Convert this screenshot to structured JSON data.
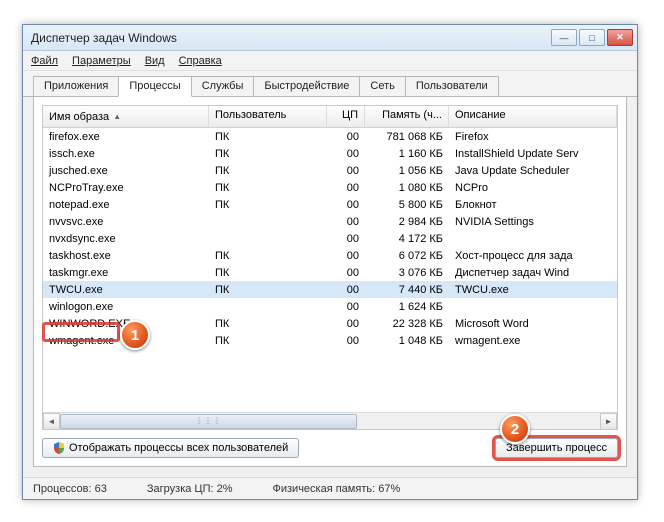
{
  "window": {
    "title": "Диспетчер задач Windows"
  },
  "menu": {
    "file": "Файл",
    "options": "Параметры",
    "view": "Вид",
    "help": "Справка"
  },
  "tabs": [
    "Приложения",
    "Процессы",
    "Службы",
    "Быстродействие",
    "Сеть",
    "Пользователи"
  ],
  "columns": {
    "image": "Имя образа",
    "user": "Пользователь",
    "cpu": "ЦП",
    "mem": "Память (ч...",
    "desc": "Описание"
  },
  "rows": [
    {
      "img": "firefox.exe",
      "user": "ПК",
      "cpu": "00",
      "mem": "781 068 КБ",
      "desc": "Firefox"
    },
    {
      "img": "issch.exe",
      "user": "ПК",
      "cpu": "00",
      "mem": "1 160 КБ",
      "desc": "InstallShield Update Serv"
    },
    {
      "img": "jusched.exe",
      "user": "ПК",
      "cpu": "00",
      "mem": "1 056 КБ",
      "desc": "Java Update Scheduler"
    },
    {
      "img": "NCProTray.exe",
      "user": "ПК",
      "cpu": "00",
      "mem": "1 080 КБ",
      "desc": "NCPro"
    },
    {
      "img": "notepad.exe",
      "user": "ПК",
      "cpu": "00",
      "mem": "5 800 КБ",
      "desc": "Блокнот"
    },
    {
      "img": "nvvsvc.exe",
      "user": "",
      "cpu": "00",
      "mem": "2 984 КБ",
      "desc": "NVIDIA Settings"
    },
    {
      "img": "nvxdsync.exe",
      "user": "",
      "cpu": "00",
      "mem": "4 172 КБ",
      "desc": ""
    },
    {
      "img": "taskhost.exe",
      "user": "ПК",
      "cpu": "00",
      "mem": "6 072 КБ",
      "desc": "Хост-процесс для зада"
    },
    {
      "img": "taskmgr.exe",
      "user": "ПК",
      "cpu": "00",
      "mem": "3 076 КБ",
      "desc": "Диспетчер задач Wind"
    },
    {
      "img": "TWCU.exe",
      "user": "ПК",
      "cpu": "00",
      "mem": "7 440 КБ",
      "desc": "TWCU.exe",
      "selected": true
    },
    {
      "img": "winlogon.exe",
      "user": "",
      "cpu": "00",
      "mem": "1 624 КБ",
      "desc": ""
    },
    {
      "img": "WINWORD.EXE",
      "user": "ПК",
      "cpu": "00",
      "mem": "22 328 КБ",
      "desc": "Microsoft Word"
    },
    {
      "img": "wmagent.exe",
      "user": "ПК",
      "cpu": "00",
      "mem": "1 048 КБ",
      "desc": "wmagent.exe"
    }
  ],
  "buttons": {
    "show_all_users": "Отображать процессы всех пользователей",
    "end_process": "Завершить процесс"
  },
  "status": {
    "processes_label": "Процессов:",
    "processes": "63",
    "cpu_label": "Загрузка ЦП:",
    "cpu": "2%",
    "mem_label": "Физическая память:",
    "mem": "67%"
  },
  "markers": {
    "one": "1",
    "two": "2"
  }
}
